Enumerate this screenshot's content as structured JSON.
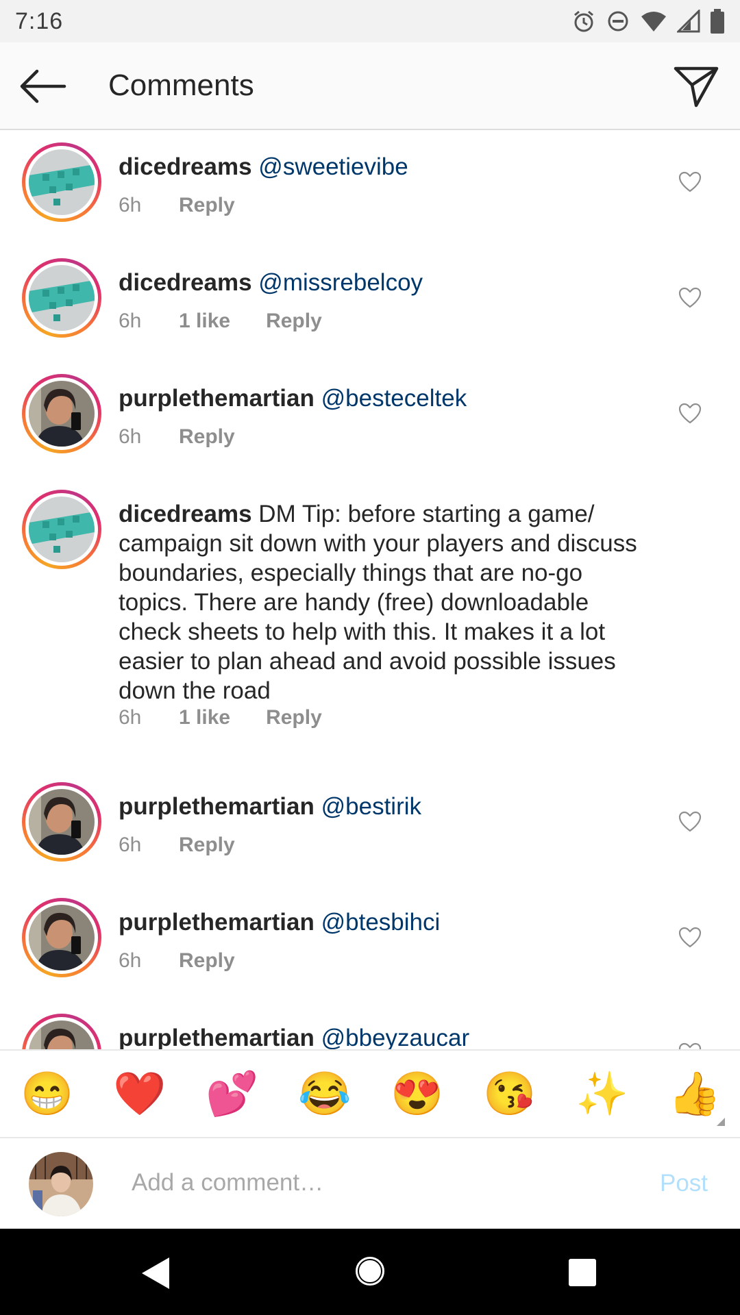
{
  "status_bar": {
    "time": "7:16",
    "icons": [
      "alarm-icon",
      "do-not-disturb-icon",
      "wifi-icon",
      "signal-icon",
      "battery-icon"
    ]
  },
  "header": {
    "title": "Comments",
    "back_icon": "back-arrow-icon",
    "share_icon": "direct-send-icon"
  },
  "comments": [
    {
      "username": "dicedreams",
      "text": "@sweetievibe",
      "age": "6h",
      "likes": "",
      "reply": "Reply",
      "avatar": "dice-avatar"
    },
    {
      "username": "dicedreams",
      "text": "@missrebelcoy",
      "age": "6h",
      "likes": "1 like",
      "reply": "Reply",
      "avatar": "dice-avatar"
    },
    {
      "username": "purplethemartian",
      "text": "@besteceltek",
      "age": "6h",
      "likes": "",
      "reply": "Reply",
      "avatar": "selfie-avatar"
    },
    {
      "username": "dicedreams",
      "text": "DM Tip: before starting a game/ campaign sit down with your players and discuss boundaries, especially things that are no-go topics. There are handy (free) downloadable check sheets to help with this. It makes it a lot easier to plan ahead and avoid possible issues down the road",
      "age": "6h",
      "likes": "1 like",
      "reply": "Reply",
      "avatar": "dice-avatar"
    },
    {
      "username": "purplethemartian",
      "text": "@bestirik",
      "age": "6h",
      "likes": "",
      "reply": "Reply",
      "avatar": "selfie-avatar"
    },
    {
      "username": "purplethemartian",
      "text": "@btesbihci",
      "age": "6h",
      "likes": "",
      "reply": "Reply",
      "avatar": "selfie-avatar"
    },
    {
      "username": "purplethemartian",
      "text": "@bbeyzaucar",
      "age": "",
      "likes": "",
      "reply": "",
      "avatar": "selfie-avatar"
    }
  ],
  "emoji_bar": [
    "😁",
    "❤️",
    "💕",
    "😂",
    "😍",
    "😘",
    "✨",
    "👍"
  ],
  "input": {
    "placeholder": "Add a comment…",
    "post_label": "Post"
  },
  "colors": {
    "mention": "#00376b",
    "meta": "#8e8e8e",
    "post_disabled": "#b2dffc",
    "ring_gradient": [
      "#f5a623",
      "#e1306c",
      "#c13584"
    ]
  }
}
